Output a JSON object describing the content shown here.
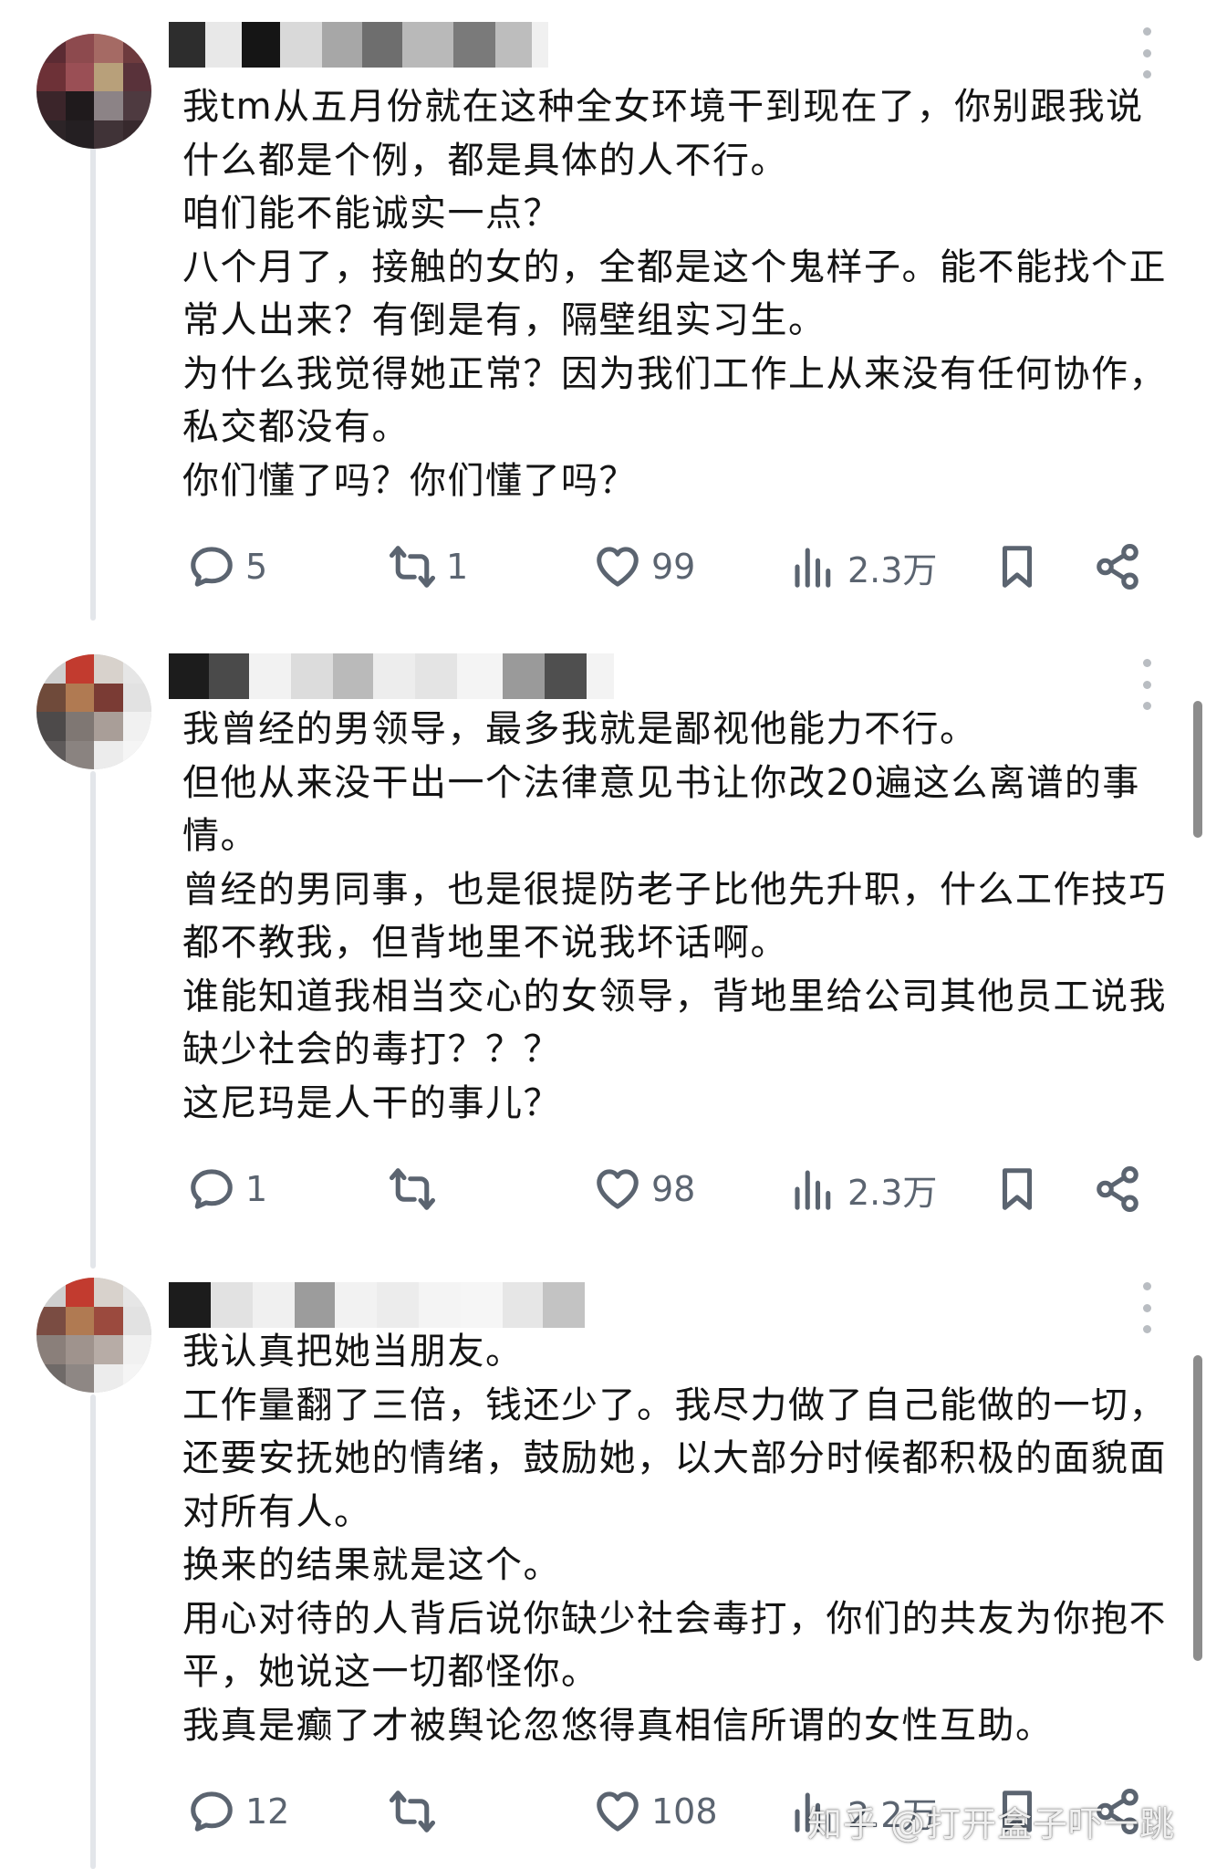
{
  "posts": [
    {
      "paragraphs": [
        "我tm从五月份就在这种全女环境干到现在了，你别跟我说什么都是个例，都是具体的人不行。",
        "咱们能不能诚实一点？",
        "八个月了，接触的女的，全都是这个鬼样子。能不能找个正常人出来？有倒是有，隔壁组实习生。",
        "为什么我觉得她正常？因为我们工作上从来没有任何协作，私交都没有。",
        "你们懂了吗？你们懂了吗？"
      ],
      "stats": {
        "replies": "5",
        "reposts": "1",
        "likes": "99",
        "views": "2.3万"
      }
    },
    {
      "paragraphs": [
        "我曾经的男领导，最多我就是鄙视他能力不行。",
        "但他从来没干出一个法律意见书让你改20遍这么离谱的事情。",
        "曾经的男同事，也是很提防老子比他先升职，什么工作技巧都不教我，但背地里不说我坏话啊。",
        "谁能知道我相当交心的女领导，背地里给公司其他员工说我缺少社会的毒打？？？",
        "这尼玛是人干的事儿？"
      ],
      "stats": {
        "replies": "1",
        "reposts": "",
        "likes": "98",
        "views": "2.3万"
      }
    },
    {
      "paragraphs": [
        "我认真把她当朋友。",
        "工作量翻了三倍，钱还少了。我尽力做了自己能做的一切，还要安抚她的情绪，鼓励她，以大部分时候都积极的面貌面对所有人。",
        "换来的结果就是这个。",
        "用心对待的人背后说你缺少社会毒打，你们的共友为你抱不平，她说这一切都怪你。",
        "我真是癫了才被舆论忽悠得真相信所谓的女性互助。"
      ],
      "stats": {
        "replies": "12",
        "reposts": "",
        "likes": "108",
        "views": "2.2万"
      }
    }
  ],
  "watermark": "知乎 @打开盒子吓一跳",
  "icons": {
    "reply": "speech-bubble-icon",
    "repost": "repost-arrows-icon",
    "like": "heart-icon",
    "views": "bar-chart-icon",
    "bookmark": "bookmark-icon",
    "share": "share-icon",
    "more": "vertical-dots-icon"
  },
  "colors": {
    "icon": "#5b6470",
    "text": "#141414",
    "thread_line": "#e3e6ea"
  }
}
